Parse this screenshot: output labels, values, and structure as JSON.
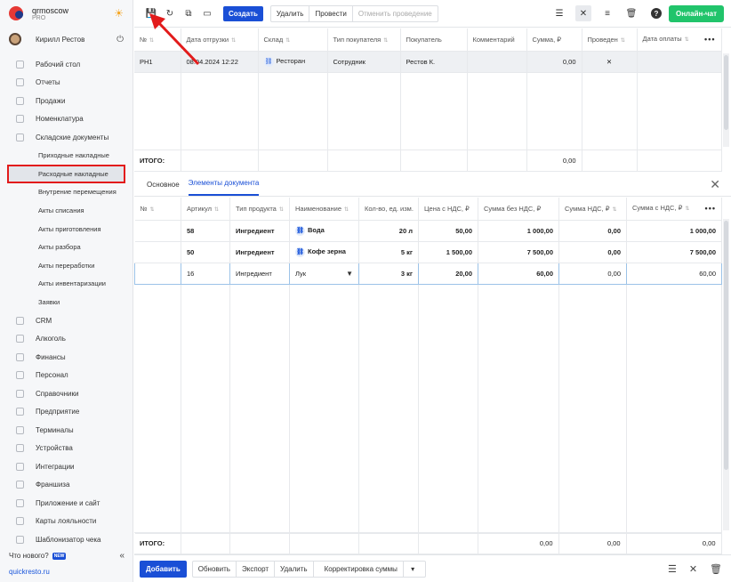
{
  "brand": {
    "name": "qrmoscow",
    "plan": "PRO"
  },
  "user": {
    "name": "Кирилл Рестов"
  },
  "sidebar": {
    "items_top": [
      {
        "label": "Рабочий стол"
      },
      {
        "label": "Отчеты"
      },
      {
        "label": "Продажи"
      },
      {
        "label": "Номенклатура"
      },
      {
        "label": "Складские документы"
      }
    ],
    "sub_items": [
      {
        "label": "Приходные накладные"
      },
      {
        "label": "Расходные накладные"
      },
      {
        "label": "Внутрение перемещения"
      },
      {
        "label": "Акты списания"
      },
      {
        "label": "Акты приготовления"
      },
      {
        "label": "Акты разбора"
      },
      {
        "label": "Акты переработки"
      },
      {
        "label": "Акты инвентаризации"
      },
      {
        "label": "Заявки"
      }
    ],
    "items_bottom": [
      {
        "label": "CRM"
      },
      {
        "label": "Алкоголь"
      },
      {
        "label": "Финансы"
      },
      {
        "label": "Персонал"
      },
      {
        "label": "Справочники"
      },
      {
        "label": "Предприятие"
      },
      {
        "label": "Терминалы"
      },
      {
        "label": "Устройства"
      },
      {
        "label": "Интеграции"
      },
      {
        "label": "Франшиза"
      },
      {
        "label": "Приложение и сайт"
      },
      {
        "label": "Карты лояльности"
      },
      {
        "label": "Шаблонизатор чека"
      }
    ],
    "whats_new": "Что нового?",
    "new_badge": "NEW",
    "site": "quickresto.ru"
  },
  "toolbar": {
    "create": "Создать",
    "delete": "Удалить",
    "post": "Провести",
    "unpost": "Отменить проведение",
    "chat": "Онлайн-чат"
  },
  "docs_table": {
    "columns": [
      "№",
      "Дата отгрузки",
      "Склад",
      "Тип покупателя",
      "Покупатель",
      "Комментарий",
      "Сумма, ₽",
      "Проведен",
      "Дата оплаты"
    ],
    "rows": [
      {
        "num": "РН1",
        "date": "08.04.2024 12:22",
        "warehouse": "Ресторан",
        "buyer_type": "Сотрудник",
        "buyer": "Рестов К.",
        "comment": "",
        "sum": "0,00",
        "posted": "✕",
        "pay_date": ""
      }
    ],
    "total_label": "ИТОГО:",
    "total_sum": "0,00"
  },
  "tabs": [
    {
      "label": "Основное"
    },
    {
      "label": "Элементы документа"
    }
  ],
  "items_table": {
    "columns": [
      "№",
      "Артикул",
      "Тип продукта",
      "Наименование",
      "Кол-во, ед. изм.",
      "Цена с НДС, ₽",
      "Сумма без НДС, ₽",
      "Сумма НДС, ₽",
      "Сумма с НДС, ₽"
    ],
    "rows": [
      {
        "num": "",
        "article": "58",
        "type": "Ингредиент",
        "name": "Вода",
        "qty": "20 л",
        "price": "50,00",
        "sum_no_vat": "1 000,00",
        "vat": "0,00",
        "sum_vat": "1 000,00"
      },
      {
        "num": "",
        "article": "50",
        "type": "Ингредиент",
        "name": "Кофе зерна",
        "qty": "5 кг",
        "price": "1 500,00",
        "sum_no_vat": "7 500,00",
        "vat": "0,00",
        "sum_vat": "7 500,00"
      }
    ],
    "edit_row": {
      "article": "16",
      "type": "Ингредиент",
      "name": "Лук",
      "qty": "3 кг",
      "price": "20,00",
      "sum_no_vat": "60,00",
      "vat": "0,00",
      "sum_vat": "60,00"
    },
    "total_label": "ИТОГО:",
    "totals": {
      "sum_no_vat": "0,00",
      "vat": "0,00",
      "sum_vat": "0,00"
    }
  },
  "bottom": {
    "add": "Добавить",
    "refresh": "Обновить",
    "export": "Экспорт",
    "delete": "Удалить",
    "correction": "Корректировка суммы"
  },
  "colors": {
    "accent": "#1a4fd6",
    "chat": "#21c46b",
    "highlight": "#e21b1b"
  }
}
